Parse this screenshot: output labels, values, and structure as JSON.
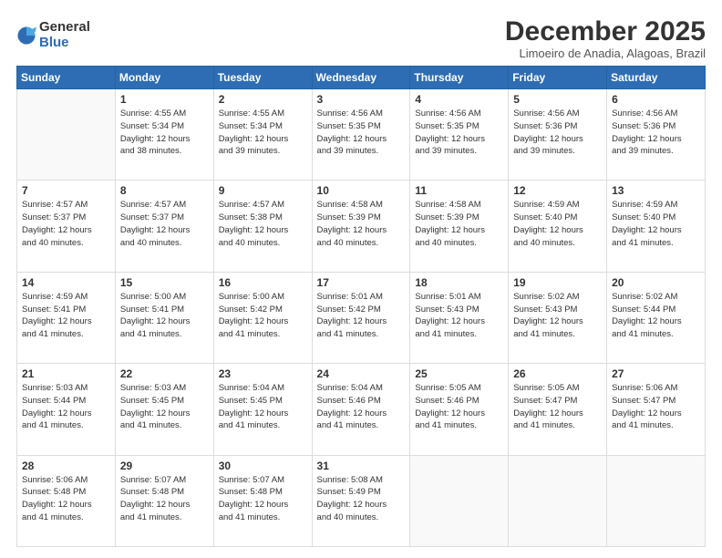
{
  "logo": {
    "general": "General",
    "blue": "Blue"
  },
  "title": "December 2025",
  "location": "Limoeiro de Anadia, Alagoas, Brazil",
  "days_header": [
    "Sunday",
    "Monday",
    "Tuesday",
    "Wednesday",
    "Thursday",
    "Friday",
    "Saturday"
  ],
  "weeks": [
    [
      {
        "day": "",
        "info": ""
      },
      {
        "day": "1",
        "info": "Sunrise: 4:55 AM\nSunset: 5:34 PM\nDaylight: 12 hours\nand 38 minutes."
      },
      {
        "day": "2",
        "info": "Sunrise: 4:55 AM\nSunset: 5:34 PM\nDaylight: 12 hours\nand 39 minutes."
      },
      {
        "day": "3",
        "info": "Sunrise: 4:56 AM\nSunset: 5:35 PM\nDaylight: 12 hours\nand 39 minutes."
      },
      {
        "day": "4",
        "info": "Sunrise: 4:56 AM\nSunset: 5:35 PM\nDaylight: 12 hours\nand 39 minutes."
      },
      {
        "day": "5",
        "info": "Sunrise: 4:56 AM\nSunset: 5:36 PM\nDaylight: 12 hours\nand 39 minutes."
      },
      {
        "day": "6",
        "info": "Sunrise: 4:56 AM\nSunset: 5:36 PM\nDaylight: 12 hours\nand 39 minutes."
      }
    ],
    [
      {
        "day": "7",
        "info": "Sunrise: 4:57 AM\nSunset: 5:37 PM\nDaylight: 12 hours\nand 40 minutes."
      },
      {
        "day": "8",
        "info": "Sunrise: 4:57 AM\nSunset: 5:37 PM\nDaylight: 12 hours\nand 40 minutes."
      },
      {
        "day": "9",
        "info": "Sunrise: 4:57 AM\nSunset: 5:38 PM\nDaylight: 12 hours\nand 40 minutes."
      },
      {
        "day": "10",
        "info": "Sunrise: 4:58 AM\nSunset: 5:39 PM\nDaylight: 12 hours\nand 40 minutes."
      },
      {
        "day": "11",
        "info": "Sunrise: 4:58 AM\nSunset: 5:39 PM\nDaylight: 12 hours\nand 40 minutes."
      },
      {
        "day": "12",
        "info": "Sunrise: 4:59 AM\nSunset: 5:40 PM\nDaylight: 12 hours\nand 40 minutes."
      },
      {
        "day": "13",
        "info": "Sunrise: 4:59 AM\nSunset: 5:40 PM\nDaylight: 12 hours\nand 41 minutes."
      }
    ],
    [
      {
        "day": "14",
        "info": "Sunrise: 4:59 AM\nSunset: 5:41 PM\nDaylight: 12 hours\nand 41 minutes."
      },
      {
        "day": "15",
        "info": "Sunrise: 5:00 AM\nSunset: 5:41 PM\nDaylight: 12 hours\nand 41 minutes."
      },
      {
        "day": "16",
        "info": "Sunrise: 5:00 AM\nSunset: 5:42 PM\nDaylight: 12 hours\nand 41 minutes."
      },
      {
        "day": "17",
        "info": "Sunrise: 5:01 AM\nSunset: 5:42 PM\nDaylight: 12 hours\nand 41 minutes."
      },
      {
        "day": "18",
        "info": "Sunrise: 5:01 AM\nSunset: 5:43 PM\nDaylight: 12 hours\nand 41 minutes."
      },
      {
        "day": "19",
        "info": "Sunrise: 5:02 AM\nSunset: 5:43 PM\nDaylight: 12 hours\nand 41 minutes."
      },
      {
        "day": "20",
        "info": "Sunrise: 5:02 AM\nSunset: 5:44 PM\nDaylight: 12 hours\nand 41 minutes."
      }
    ],
    [
      {
        "day": "21",
        "info": "Sunrise: 5:03 AM\nSunset: 5:44 PM\nDaylight: 12 hours\nand 41 minutes."
      },
      {
        "day": "22",
        "info": "Sunrise: 5:03 AM\nSunset: 5:45 PM\nDaylight: 12 hours\nand 41 minutes."
      },
      {
        "day": "23",
        "info": "Sunrise: 5:04 AM\nSunset: 5:45 PM\nDaylight: 12 hours\nand 41 minutes."
      },
      {
        "day": "24",
        "info": "Sunrise: 5:04 AM\nSunset: 5:46 PM\nDaylight: 12 hours\nand 41 minutes."
      },
      {
        "day": "25",
        "info": "Sunrise: 5:05 AM\nSunset: 5:46 PM\nDaylight: 12 hours\nand 41 minutes."
      },
      {
        "day": "26",
        "info": "Sunrise: 5:05 AM\nSunset: 5:47 PM\nDaylight: 12 hours\nand 41 minutes."
      },
      {
        "day": "27",
        "info": "Sunrise: 5:06 AM\nSunset: 5:47 PM\nDaylight: 12 hours\nand 41 minutes."
      }
    ],
    [
      {
        "day": "28",
        "info": "Sunrise: 5:06 AM\nSunset: 5:48 PM\nDaylight: 12 hours\nand 41 minutes."
      },
      {
        "day": "29",
        "info": "Sunrise: 5:07 AM\nSunset: 5:48 PM\nDaylight: 12 hours\nand 41 minutes."
      },
      {
        "day": "30",
        "info": "Sunrise: 5:07 AM\nSunset: 5:48 PM\nDaylight: 12 hours\nand 41 minutes."
      },
      {
        "day": "31",
        "info": "Sunrise: 5:08 AM\nSunset: 5:49 PM\nDaylight: 12 hours\nand 40 minutes."
      },
      {
        "day": "",
        "info": ""
      },
      {
        "day": "",
        "info": ""
      },
      {
        "day": "",
        "info": ""
      }
    ]
  ]
}
